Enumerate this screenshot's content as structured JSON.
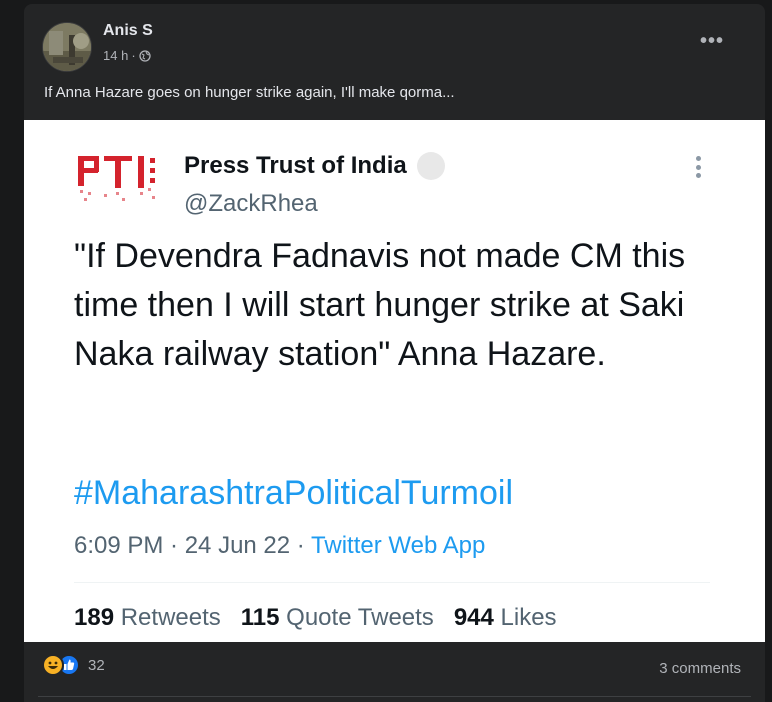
{
  "post": {
    "author": "Anis S",
    "time": "14 h",
    "separator": "·",
    "text": "If Anna Hazare goes on hunger strike again, I'll make qorma...",
    "more_label": "•••"
  },
  "tweet": {
    "name": "Press Trust of India",
    "handle": "@ZackRhea",
    "body": "\"If Devendra Fadnavis not made CM this time then I will start hunger strike at Saki Naka railway station\" Anna Hazare.",
    "hashtag": "#MaharashtraPoliticalTurmoil",
    "time": "6:09 PM · 24 Jun 22 · ",
    "source": "Twitter Web App",
    "stats": [
      {
        "count": "189",
        "label": "Retweets"
      },
      {
        "count": "115",
        "label": "Quote Tweets"
      },
      {
        "count": "944",
        "label": "Likes"
      }
    ]
  },
  "footer": {
    "reaction_count": "32",
    "comments": "3 comments"
  },
  "colors": {
    "page_bg": "#18191a",
    "card_bg": "#242526",
    "accent": "#1d9bf0",
    "pti_red": "#d4232d"
  }
}
